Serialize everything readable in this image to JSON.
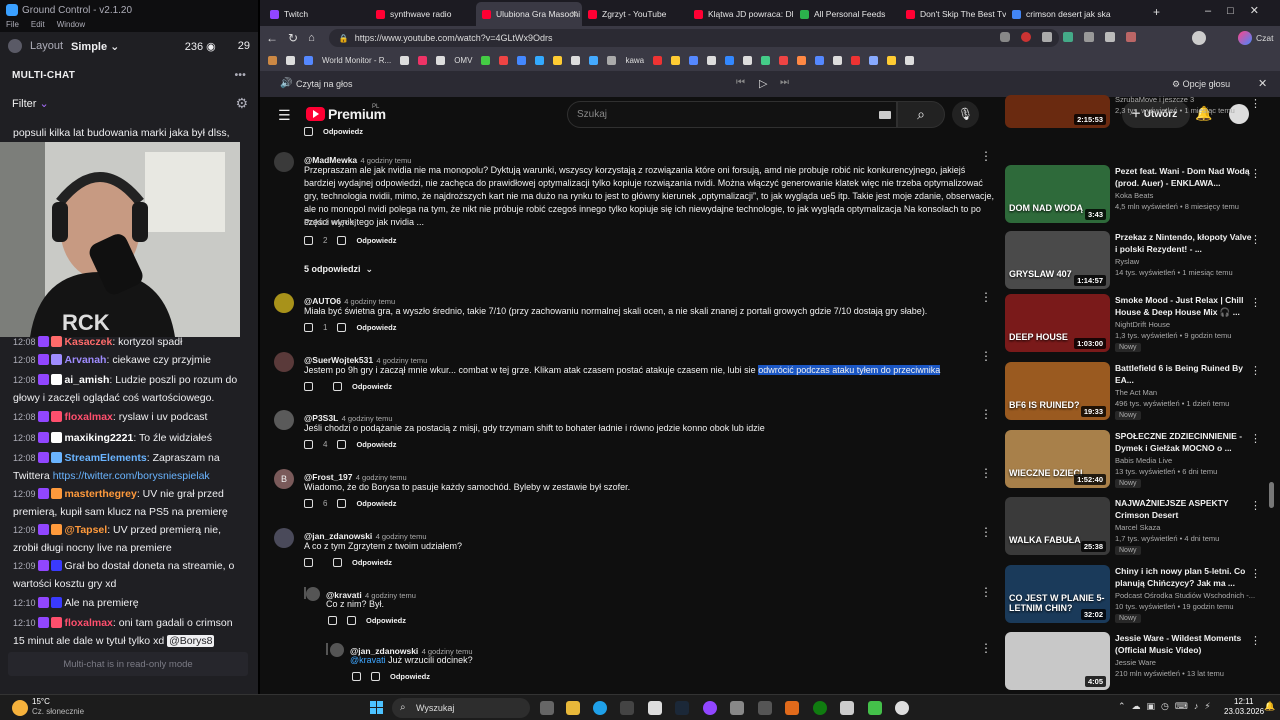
{
  "left_panel": {
    "app_title": "Ground Control - v2.1.20",
    "menu": [
      "File",
      "Edit",
      "Window"
    ],
    "layout_label": "Layout",
    "layout_value": "Simple",
    "viewer_count": "236",
    "viewer_count2": "29",
    "multichat_title": "MULTI-CHAT",
    "filter_label": "Filter",
    "top_message": "popsuli kilka lat budowania marki jaka był dlss,",
    "messages": [
      {
        "time": "12:08",
        "user": "Kasaczek",
        "text": "kortyzol spadł",
        "color": "#ff6b6b"
      },
      {
        "time": "12:08",
        "user": "Arvanah",
        "text": "ciekawe czy przyjmie",
        "color": "#9f8cff"
      },
      {
        "time": "12:08",
        "user": "ai_amish",
        "text": "Ludzie poszli po rozum do głowy i zaczęli oglądać coś wartościowego.",
        "color": "#ffffff"
      },
      {
        "time": "12:08",
        "user": "floxalmax",
        "text": "ryslaw i uv podcast",
        "color": "#ff4f6d"
      },
      {
        "time": "12:08",
        "user": "maxiking2221",
        "text": "To źle widziałeś",
        "color": "#ffffff"
      },
      {
        "time": "12:08",
        "user": "StreamElements",
        "text": "Zapraszam na Twittera",
        "link": "https://twitter.com/borysniespielak",
        "color": "#6ab4ff"
      },
      {
        "time": "12:09",
        "user": "masterthegrey",
        "text": "UV nie grał przed premierą, kupił sam klucz na PS5 na premierę",
        "color": "#ff9a3c"
      },
      {
        "time": "12:09",
        "user": "@Tapsel",
        "text": "UV przed premierą nie, zrobił długi nocny live na premiere",
        "color": "#ff9a3c"
      },
      {
        "time": "12:09",
        "user": "",
        "text": "Grał bo dostał doneta na streamie, o wartości kosztu gry xd",
        "color": "#3a3aff"
      },
      {
        "time": "12:10",
        "user": "",
        "text": "Ale na premierę",
        "color": "#3a3aff"
      },
      {
        "time": "12:10",
        "user": "floxalmax",
        "text": "oni tam gadali o crimson 15 minut ale dale w tytuł tylko xd",
        "mention": "@Borys8",
        "color": "#ff4f6d"
      }
    ],
    "readonly_notice": "Multi-chat is in read-only mode"
  },
  "browser": {
    "tabs": [
      {
        "label": "Twitch",
        "color": "#9146ff"
      },
      {
        "label": "synthwave radio",
        "color": "#ff0033"
      },
      {
        "label": "Ulubiona Gra Masochi",
        "color": "#ff0033",
        "active": true
      },
      {
        "label": "Zgrzyt - YouTube",
        "color": "#ff0033"
      },
      {
        "label": "Klątwa JD powraca: Dl",
        "color": "#ff0033"
      },
      {
        "label": "All Personal Feeds",
        "color": "#2bb24c"
      },
      {
        "label": "Don't Skip The Best Tv",
        "color": "#ff0033"
      },
      {
        "label": "crimson desert jak ska",
        "color": "#4285f4"
      }
    ],
    "new_tab": "+",
    "url": "https://www.youtube.com/watch?v=4GLtWx9Odrs",
    "bookmarks": [
      "World Monitor - R...",
      "OMV",
      "kawa"
    ],
    "read_aloud": "Czytaj na głos",
    "voice_options": "Opcje głosu",
    "chat_label": "Czat"
  },
  "youtube": {
    "logo": "Premium",
    "logo_region": "PL",
    "search_placeholder": "Szukaj",
    "create_label": "Utwórz",
    "comments": [
      {
        "author": "@MadMewka",
        "time": "4 godziny temu",
        "text": "Przepraszam ale jak nvidia nie ma monopolu? Dyktują warunki, wszyscy korzystają z rozwiązania które oni forsują, amd nie probuje robić nic konkurencyjnego, jakiejś bardziej wydajnej odpowiedzi, nie zachęca do prawidłowej optymalizacji tylko kopiuje rozwiązania nvidi. Można włączyć generowanie klatek więc nie trzeba optymalizować gry, technologia nvidii, mimo, że najdroższych kart nie ma dużo na rynku to jest to główny kierunek „optymalizacji”, to jak wygląda ue5 itp. Takie jest moje zdanie, obserwacje, ale no monopol nvidi polega na tym, że nikt nie próbuje robić czegoś innego tylko kopiuje się ich niewydajne technologie, to jak wygląda optymalizacja Na konsolach to po części wynik tego jak nvidia ...",
        "more": "Pokaż więcej",
        "likes": "2",
        "replies_toggle": "5 odpowiedzi"
      },
      {
        "author": "@AUTO6",
        "time": "4 godziny temu",
        "text": "Miała być świetna gra, a wyszło średnio, takie 7/10 (przy zachowaniu normalnej skali ocen, a nie skali znanej z portali growych gdzie 7/10 dostają gry słabe).",
        "likes": "1"
      },
      {
        "author": "@SuerWojtek531",
        "time": "4 godziny temu",
        "text": "Jestem po 9h gry i zaczął mnie wkur... combat w tej grze. Klikam atak czasem postać atakuje czasem nie, lubi sie ",
        "highlight": "odwrócić podczas ataku tyłem do przeciwnika",
        "likes": ""
      },
      {
        "author": "@P3S3L",
        "time": "4 godziny temu",
        "text": "Jeśli chodzi o podążanie za postacią z misji, gdy trzymam shift to bohater ładnie i równo jedzie konno obok lub idzie",
        "likes": "4"
      },
      {
        "author": "@Frost_197",
        "time": "4 godziny temu",
        "text": "Wiadomo, że do Borysa to pasuje każdy samochód. Byleby w zestawie był szofer.",
        "likes": "6",
        "avatar_letter": "B"
      },
      {
        "author": "@jan_zdanowski",
        "time": "4 godziny temu",
        "text": "A co z tym Zgrzytem z twoim udziałem?",
        "likes": ""
      }
    ],
    "replies": [
      {
        "author": "@kravati",
        "time": "4 godziny temu",
        "text": "Co z nim? Był."
      },
      {
        "author": "@jan_zdanowski",
        "time": "4 godziny temu",
        "mention": "@kravati",
        "text": " Już wrzucili odcinek?"
      }
    ],
    "reply_label": "Odpowiedz",
    "sidebar": [
      {
        "title": "",
        "channel": "SzrubaMove i jeszcze 3",
        "meta": "2,3 tys. wyświetleń • 1 miesiąc temu",
        "duration": "2:15:53",
        "thumb": "#6a2a10"
      },
      {
        "title": "Pezet feat. Wani - Dom Nad Wodą (prod. Auer) - ENKLAWA...",
        "channel": "Koka Beats",
        "meta": "4,5 mln wyświetleń • 8 miesięcy temu",
        "duration": "3:43",
        "thumb": "#2e6a3a",
        "thumb_text": "DOM NAD WODĄ"
      },
      {
        "title": "Przekaz z Nintendo, kłopoty Valve i polski Rezydent! - ...",
        "channel": "Ryslaw",
        "meta": "14 tys. wyświetleń • 1 miesiąc temu",
        "duration": "1:14:57",
        "thumb": "#4a4a4a",
        "thumb_text": "GRYSLAW 407"
      },
      {
        "title": "Smoke Mood - Just Relax | Chill House & Deep House Mix 🎧 ...",
        "channel": "NightDrift House",
        "meta": "1,3 tys. wyświetleń • 9 godzin temu",
        "duration": "1:03:00",
        "thumb": "#7a1a1a",
        "thumb_text": "DEEP HOUSE",
        "new": "Nowy"
      },
      {
        "title": "Battlefield 6 is Being Ruined By EA...",
        "channel": "The Act Man",
        "meta": "496 tys. wyświetleń • 1 dzień temu",
        "duration": "19:33",
        "thumb": "#9a5a20",
        "thumb_text": "BF6 IS RUINED?",
        "new": "Nowy"
      },
      {
        "title": "SPOŁECZNE ZDZIECINNIENIE - Dymek i Giełżak MOCNO o ...",
        "channel": "Babis Media Live",
        "meta": "13 tys. wyświetleń • 6 dni temu",
        "duration": "1:52:40",
        "thumb": "#a8804a",
        "thumb_text": "WIECZNE DZIECI",
        "new": "Nowy"
      },
      {
        "title": "NAJWAŻNIEJSZE ASPEKTY Crimson Desert",
        "channel": "Marcel Skaza",
        "meta": "1,7 tys. wyświetleń • 4 dni temu",
        "duration": "25:38",
        "thumb": "#3a3a3a",
        "thumb_text": "WALKA FABUŁA",
        "new": "Nowy"
      },
      {
        "title": "Chiny i ich nowy plan 5-letni. Co planują Chińczycy? Jak ma ...",
        "channel": "Podcast Ośrodka Studiów Wschodnich -...",
        "meta": "10 tys. wyświetleń • 19 godzin temu",
        "duration": "32:02",
        "thumb": "#1a3a5a",
        "thumb_text": "CO JEST W PLANIE 5-LETNIM CHIN?",
        "new": "Nowy"
      },
      {
        "title": "Jessie Ware - Wildest Moments (Official Music Video)",
        "channel": "Jessie Ware",
        "meta": "210 mln wyświetleń • 13 lat temu",
        "duration": "4:05",
        "thumb": "#c8c8c8"
      }
    ]
  },
  "taskbar": {
    "temp": "15°C",
    "weather": "Cz. słonecznie",
    "search": "Wyszukaj",
    "time": "12:11",
    "date": "23.03.2026"
  }
}
